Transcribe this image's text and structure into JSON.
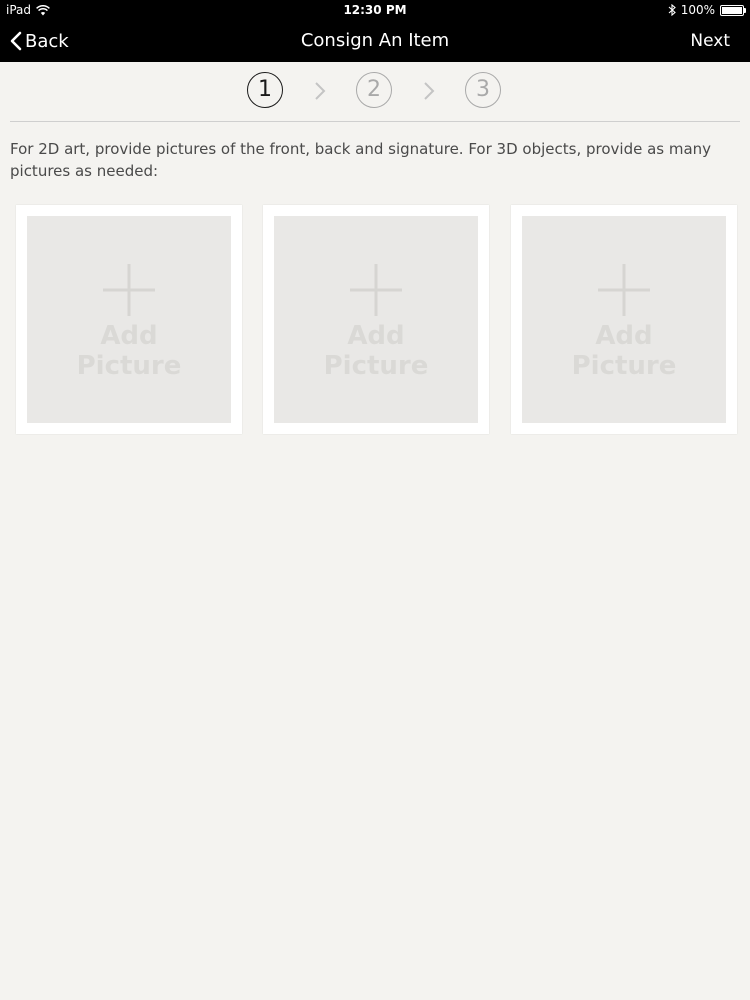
{
  "status_bar": {
    "carrier": "iPad",
    "time": "12:30 PM",
    "battery_text": "100%",
    "battery_level": 1.0
  },
  "nav": {
    "back_label": "Back",
    "title": "Consign An Item",
    "next_label": "Next"
  },
  "steps": [
    {
      "label": "1",
      "active": true
    },
    {
      "label": "2",
      "active": false
    },
    {
      "label": "3",
      "active": false
    }
  ],
  "instructions": "For 2D art, provide pictures of the front, back and signature.  For 3D objects, provide as many pictures as needed:",
  "photo_slots": [
    {
      "line1": "Add",
      "line2": "Picture"
    },
    {
      "line1": "Add",
      "line2": "Picture"
    },
    {
      "line1": "Add",
      "line2": "Picture"
    }
  ],
  "colors": {
    "nav_background": "#000000",
    "page_background": "#f4f3f0",
    "step_active": "#1a1a1a",
    "step_inactive": "#a9a9a9"
  }
}
